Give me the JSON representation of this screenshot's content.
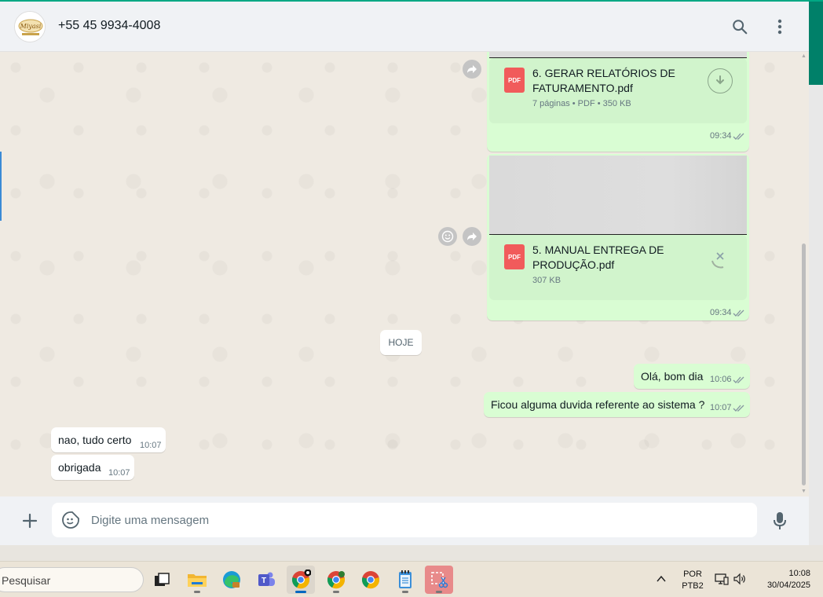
{
  "header": {
    "contact_name": "+55 45 9934-4008",
    "avatar_icon": "company-logo-avatar",
    "search_icon": "search-icon",
    "menu_icon": "more-vertical-icon"
  },
  "messages": {
    "doc1": {
      "title_line1": "6. GERAR RELATÓRIOS DE",
      "title_line2": "FATURAMENTO.pdf",
      "meta": "7 páginas • PDF • 350 KB",
      "badge": "PDF",
      "time": "09:34",
      "status": "read"
    },
    "doc2": {
      "title_line1": "5. MANUAL ENTREGA DE",
      "title_line2": "PRODUÇÃO.pdf",
      "meta": "307 KB",
      "badge": "PDF",
      "time": "09:34",
      "status": "read"
    },
    "day_separator": "HOJE",
    "out1": {
      "text": "Olá, bom dia",
      "time": "10:06"
    },
    "out2": {
      "text": "Ficou alguma duvida referente ao sistema ?",
      "time": "10:07"
    },
    "in1": {
      "text": "nao, tudo certo",
      "time": "10:07"
    },
    "in2": {
      "text": "obrigada",
      "time": "10:07"
    }
  },
  "footer": {
    "input_placeholder": "Digite uma mensagem",
    "input_value": ""
  },
  "taskbar": {
    "search_placeholder": "Pesquisar",
    "lang_line1": "POR",
    "lang_line2": "PTB2",
    "time": "10:08",
    "date": "30/04/2025",
    "apps": [
      "task-view",
      "file-explorer",
      "edge",
      "teams",
      "chrome-active",
      "chrome-profile",
      "chrome",
      "notepad",
      "snipping-tool"
    ]
  },
  "colors": {
    "outgoing_bubble": "#d9fdd3",
    "incoming_bubble": "#ffffff",
    "chat_background": "#efeae2",
    "accent": "#00a884",
    "pdf_red": "#f15b5b"
  }
}
